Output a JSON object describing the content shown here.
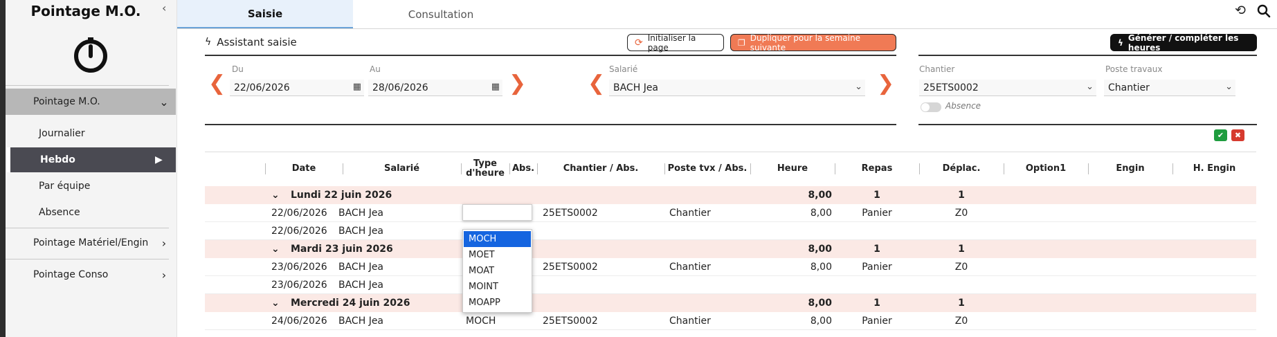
{
  "app": {
    "title": "Pointage M.O."
  },
  "sidebar": {
    "groups": [
      {
        "label": "Pointage M.O."
      },
      {
        "label": "Pointage Matériel/Engin"
      },
      {
        "label": "Pointage Conso"
      }
    ],
    "subitems": [
      {
        "label": "Journalier"
      },
      {
        "label": "Hebdo"
      },
      {
        "label": "Par équipe"
      },
      {
        "label": "Absence"
      }
    ]
  },
  "tabs": [
    {
      "label": "Saisie"
    },
    {
      "label": "Consultation"
    }
  ],
  "toolbar": {
    "assistant_label": "Assistant saisie",
    "init_label": "Initialiser la page",
    "duplicate_label": "Dupliquer pour la semaine suivante",
    "generate_label": "Générer / compléter les heures"
  },
  "filters": {
    "du_label": "Du",
    "du_value": "22/06/2026",
    "au_label": "Au",
    "au_value": "28/06/2026",
    "salarie_label": "Salarié",
    "salarie_value": "BACH Jea",
    "chantier_label": "Chantier",
    "chantier_value": "25ETS0002",
    "poste_label": "Poste travaux",
    "poste_value": "Chantier",
    "absence_label": "Absence"
  },
  "table": {
    "columns": [
      "Date",
      "Salarié",
      "Type d'heure",
      "Abs.",
      "Chantier / Abs.",
      "Poste tvx / Abs.",
      "Heure",
      "Repas",
      "Déplac.",
      "Option1",
      "Engin",
      "H. Engin"
    ],
    "days": [
      {
        "label": "Lundi 22 juin 2026",
        "heure": "8,00",
        "repas": "1",
        "deplac": "1",
        "rows": [
          {
            "date": "22/06/2026",
            "salarie": "BACH Jea",
            "type": "",
            "chantier": "25ETS0002",
            "poste": "Chantier",
            "heure": "8,00",
            "repas": "Panier",
            "deplac": "Z0"
          },
          {
            "date": "22/06/2026",
            "salarie": "BACH Jea",
            "type": "",
            "chantier": "",
            "poste": "",
            "heure": "",
            "repas": "",
            "deplac": ""
          }
        ]
      },
      {
        "label": "Mardi 23 juin 2026",
        "heure": "8,00",
        "repas": "1",
        "deplac": "1",
        "rows": [
          {
            "date": "23/06/2026",
            "salarie": "BACH Jea",
            "type": "",
            "chantier": "25ETS0002",
            "poste": "Chantier",
            "heure": "8,00",
            "repas": "Panier",
            "deplac": "Z0"
          },
          {
            "date": "23/06/2026",
            "salarie": "BACH Jea",
            "type": "",
            "chantier": "",
            "poste": "",
            "heure": "",
            "repas": "",
            "deplac": ""
          }
        ]
      },
      {
        "label": "Mercredi 24 juin 2026",
        "heure": "8,00",
        "repas": "1",
        "deplac": "1",
        "rows": [
          {
            "date": "24/06/2026",
            "salarie": "BACH Jea",
            "type": "MOCH",
            "chantier": "25ETS0002",
            "poste": "Chantier",
            "heure": "8,00",
            "repas": "Panier",
            "deplac": "Z0"
          }
        ]
      }
    ]
  },
  "dropdown": {
    "options": [
      "MOCH",
      "MOET",
      "MOAT",
      "MOINT",
      "MOAPP"
    ],
    "selected": "MOCH"
  },
  "colors": {
    "accent": "#e8643c",
    "active_tab_bg": "#e8f1fb",
    "day_row_bg": "#fbe9e5",
    "selected_option": "#1565e0"
  }
}
